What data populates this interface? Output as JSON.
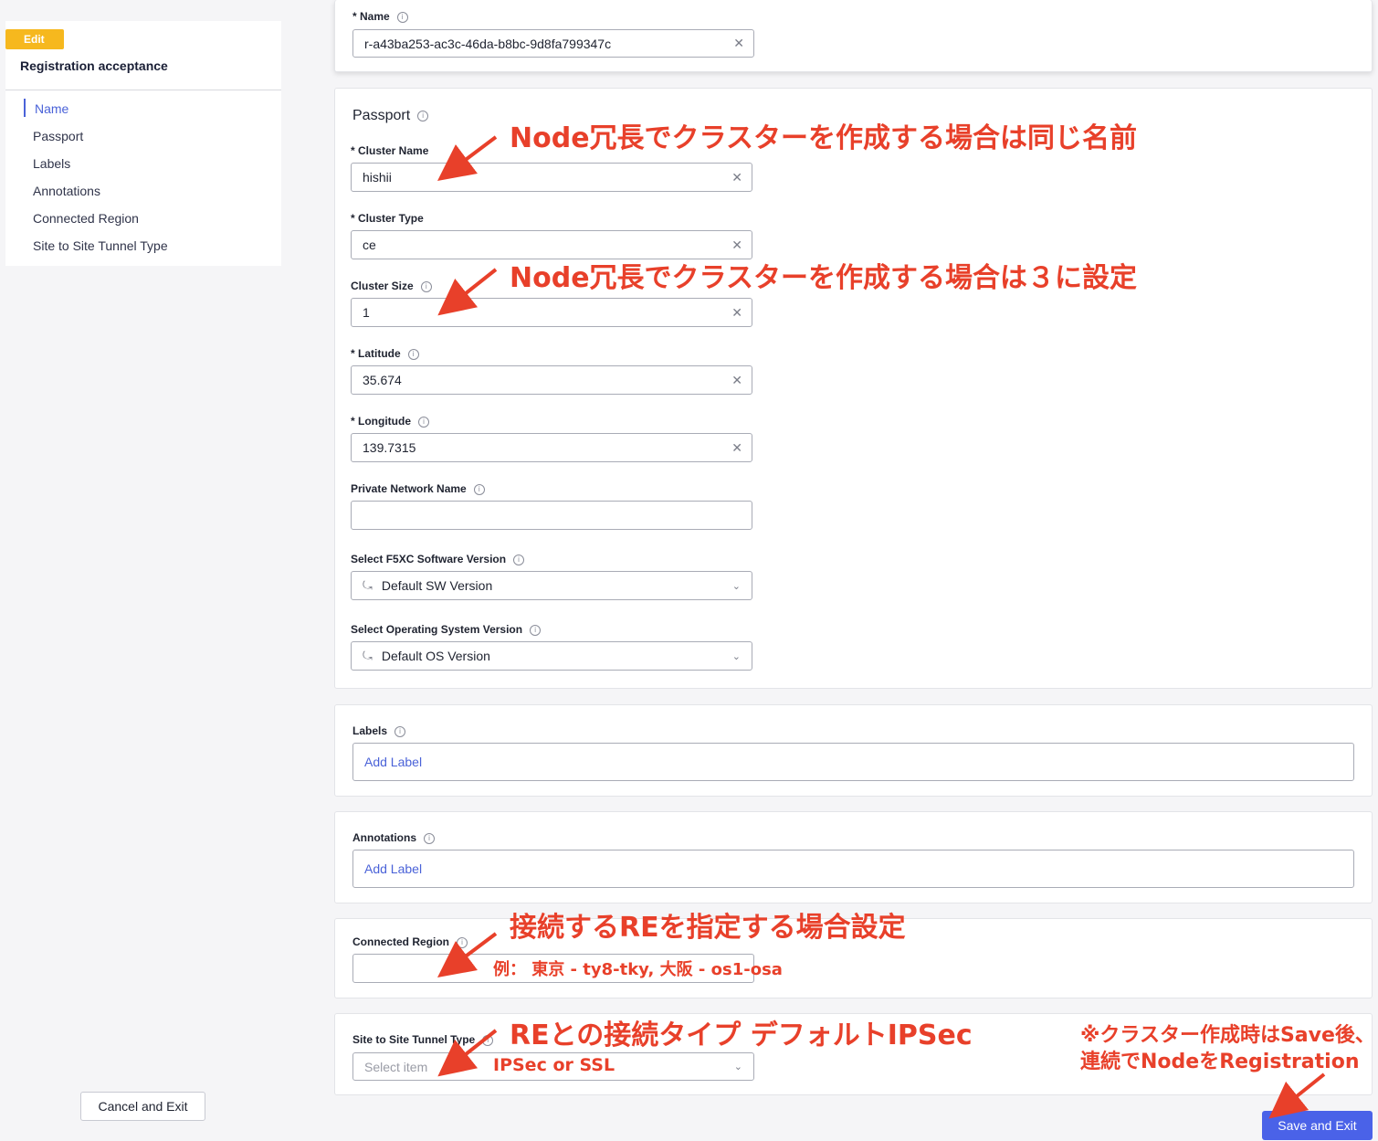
{
  "nav": {
    "badge": "Edit",
    "title": "Registration acceptance",
    "items": [
      "Name",
      "Passport",
      "Labels",
      "Annotations",
      "Connected Region",
      "Site to Site Tunnel Type"
    ]
  },
  "name_section": {
    "label": "* Name",
    "value": "r-a43ba253-ac3c-46da-b8bc-9d8fa799347c"
  },
  "passport": {
    "title": "Passport",
    "cluster_name": {
      "label": "* Cluster Name",
      "value": "hishii"
    },
    "cluster_type": {
      "label": "* Cluster Type",
      "value": "ce"
    },
    "cluster_size": {
      "label": "Cluster Size",
      "value": "1"
    },
    "latitude": {
      "label": "* Latitude",
      "value": "35.674"
    },
    "longitude": {
      "label": "* Longitude",
      "value": "139.7315"
    },
    "private_network": {
      "label": "Private Network Name",
      "value": ""
    },
    "sw_version": {
      "label": "Select F5XC Software Version",
      "value": "Default SW Version"
    },
    "os_version": {
      "label": "Select Operating System Version",
      "value": "Default OS Version"
    }
  },
  "labels": {
    "label": "Labels",
    "add": "Add Label"
  },
  "annotations": {
    "label": "Annotations",
    "add": "Add Label"
  },
  "connected_region": {
    "label": "Connected Region",
    "value": ""
  },
  "tunnel_type": {
    "label": "Site to Site Tunnel Type",
    "placeholder": "Select item"
  },
  "buttons": {
    "cancel": "Cancel and Exit",
    "save": "Save and Exit"
  },
  "overlay_notes": {
    "cluster_name_note": "Node冗長でクラスターを作成する場合は同じ名前",
    "cluster_size_note": "Node冗長でクラスターを作成する場合は３に設定",
    "region_note": "接続するREを指定する場合設定",
    "region_example": "例：  東京 - ty8-tky, 大阪 - os1-osa",
    "tunnel_note": "REとの接続タイプ デフォルトIPSec",
    "tunnel_options": "IPSec or SSL",
    "save_note_line1": "※クラスター作成時はSave後、",
    "save_note_line2": "連続でNodeをRegistration"
  },
  "colors": {
    "accent": "#4a62d8",
    "annotation": "#e8402a",
    "badge": "#f6b81e",
    "save_button": "#4a62e8"
  }
}
